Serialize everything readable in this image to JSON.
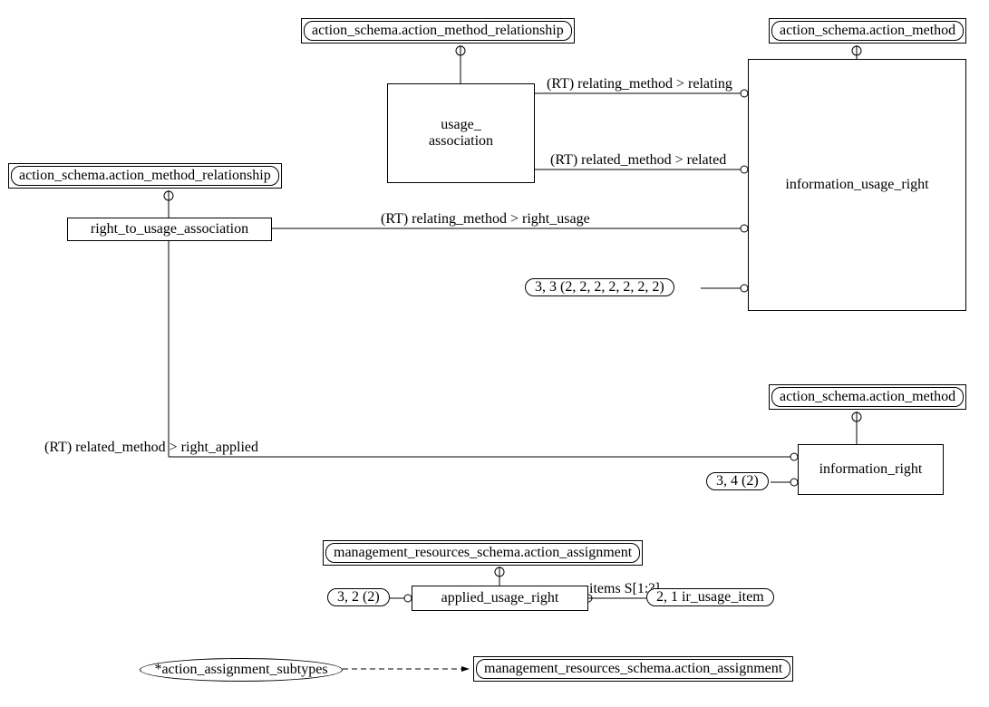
{
  "refs": {
    "top_left": "action_schema.action_method_relationship",
    "top_mid": "action_schema.action_method_relationship",
    "top_right1": "action_schema.action_method",
    "right_mid": "action_schema.action_method",
    "mgmt1": "management_resources_schema.action_assignment",
    "mgmt2": "management_resources_schema.action_assignment"
  },
  "entities": {
    "usage_association": "usage_\nassociation",
    "right_to_usage": "right_to_usage_association",
    "info_usage_right": "information_usage_right",
    "info_right": "information_right",
    "applied_usage_right": "applied_usage_right"
  },
  "labels": {
    "rt_relating": "(RT) relating_method > relating",
    "rt_related": "(RT) related_method > related",
    "rt_right_usage": "(RT) relating_method > right_usage",
    "rt_right_applied": "(RT) related_method > right_applied",
    "items": "items S[1:?]"
  },
  "pills": {
    "p1": "3, 3 (2, 2, 2, 2, 2, 2, 2)",
    "p2": "3, 4 (2)",
    "p3": "3, 2 (2)",
    "p4": "2, 1 ir_usage_item"
  },
  "ellipse": {
    "subtypes": "*action_assignment_subtypes"
  }
}
